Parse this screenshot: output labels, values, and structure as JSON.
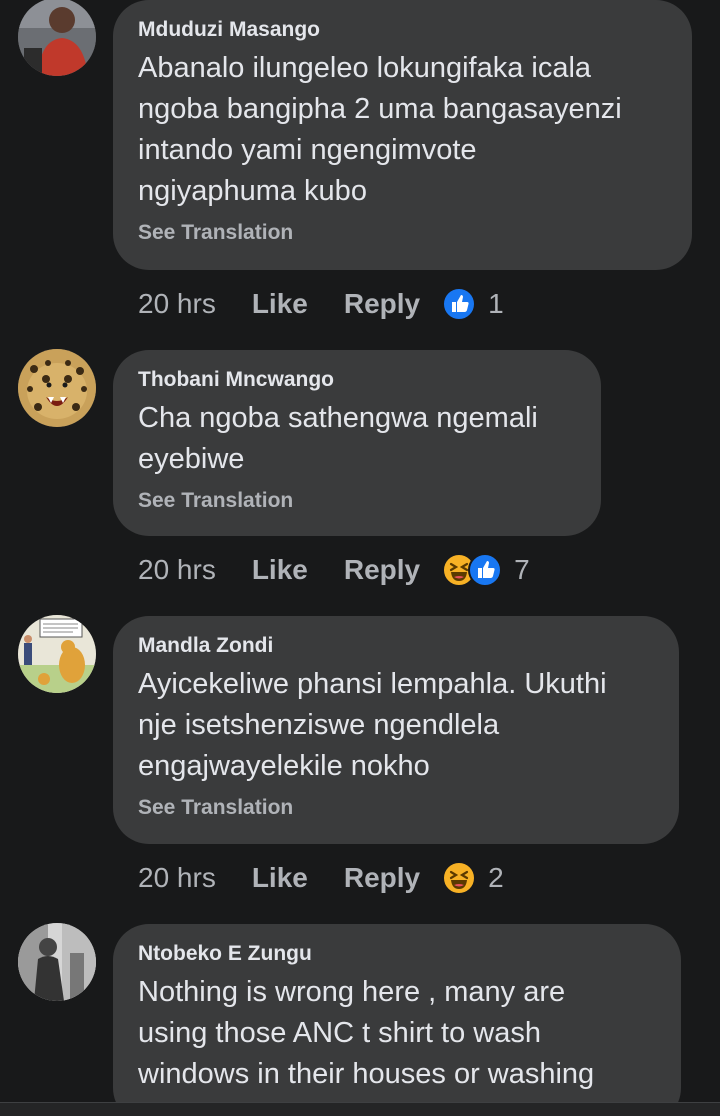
{
  "comments": [
    {
      "author": "Mduduzi Masango",
      "lines": [
        "Abanalo ilungeleo lokungifaka icala",
        "ngoba bangipha 2 uma bangasayenzi",
        "intando yami ngengimvote",
        "ngiyaphuma kubo"
      ],
      "see_translation": "See Translation",
      "time": "20 hrs",
      "like": "Like",
      "reply": "Reply",
      "reactions": [
        "like"
      ],
      "reaction_count": "1"
    },
    {
      "author": "Thobani Mncwango",
      "lines": [
        "Cha ngoba sathengwa ngemali",
        "eyebiwe"
      ],
      "see_translation": "See Translation",
      "time": "20 hrs",
      "like": "Like",
      "reply": "Reply",
      "reactions": [
        "haha",
        "like"
      ],
      "reaction_count": "7"
    },
    {
      "author": "Mandla Zondi",
      "lines": [
        "Ayicekeliwe phansi lempahla. Ukuthi",
        "nje isetshenziswe ngendlela",
        "engajwayelekile nokho"
      ],
      "see_translation": "See Translation",
      "time": "20 hrs",
      "like": "Like",
      "reply": "Reply",
      "reactions": [
        "haha"
      ],
      "reaction_count": "2"
    },
    {
      "author": "Ntobeko E Zungu",
      "lines": [
        "Nothing  is wrong here , many are",
        "using those ANC t shirt to wash",
        "windows  in their houses or washing"
      ]
    }
  ],
  "colors": {
    "background": "#18191a",
    "bubble": "#3a3b3c",
    "primary_text": "#e4e6eb",
    "secondary_text": "#b0b3b8",
    "like_blue": "#1877f2",
    "haha_yellow": "#f7b125"
  }
}
